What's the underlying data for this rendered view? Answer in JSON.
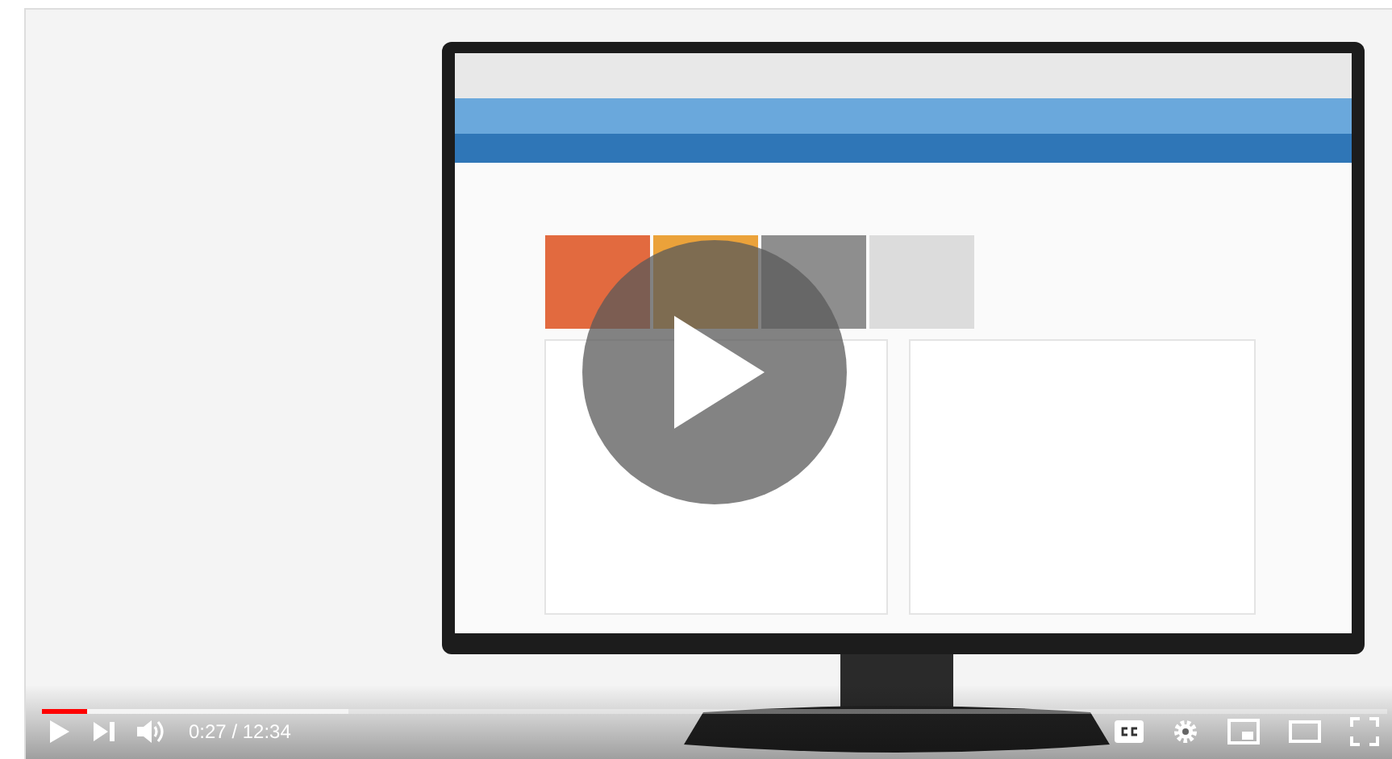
{
  "player": {
    "progress": {
      "level": 0.034
    },
    "buffer": {
      "level": 0.228
    },
    "time": "0:27 / 12:34"
  }
}
